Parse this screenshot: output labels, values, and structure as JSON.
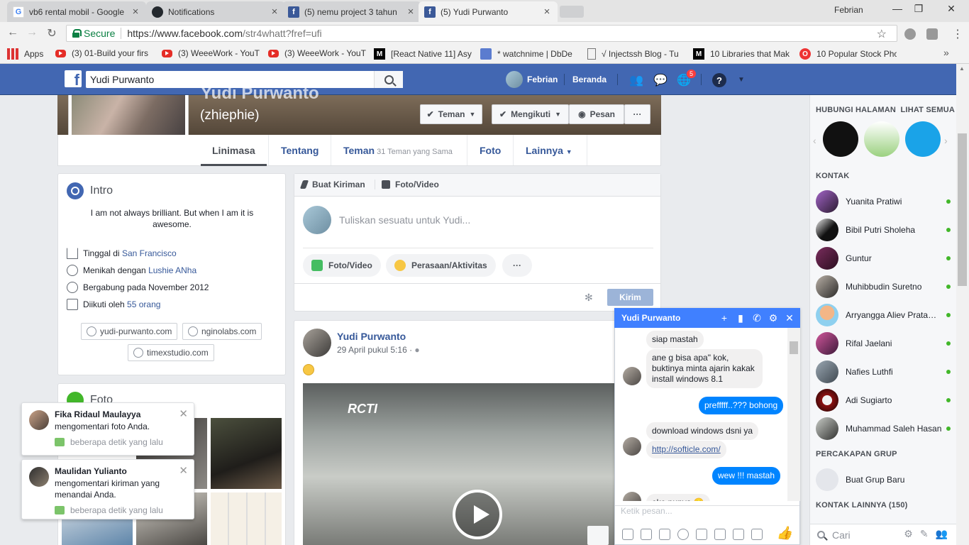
{
  "browser": {
    "tabs": [
      {
        "title": "vb6 rental mobil - Google",
        "favicon": "G",
        "color": "#4285f4"
      },
      {
        "title": "Notifications",
        "favicon": "github-icon",
        "color": "#24292e"
      },
      {
        "title": "(5) nemu project 3 tahun",
        "favicon": "f",
        "color": "#3b5998"
      },
      {
        "title": "(5) Yudi Purwanto",
        "favicon": "f",
        "color": "#3b5998"
      }
    ],
    "user": "Febrian",
    "secure_label": "Secure",
    "url_host": "https://www.facebook.com",
    "url_path": "/str4whatt?fref=ufi",
    "bookmarks": [
      {
        "label": "Apps",
        "icon": "apps-icon"
      },
      {
        "label": "(3) 01-Build your firs",
        "icon": "youtube-icon"
      },
      {
        "label": "(3) WeeeWork - YouT",
        "icon": "youtube-icon"
      },
      {
        "label": "(3) WeeeWork - YouT",
        "icon": "youtube-icon"
      },
      {
        "label": "[React Native 11] Asy",
        "icon": "medium-icon"
      },
      {
        "label": "* watchnime | DbDe",
        "icon": "page-icon"
      },
      {
        "label": "√ Injectssh Blog - Tu",
        "icon": "doc-icon"
      },
      {
        "label": "10 Libraries that Mak",
        "icon": "medium-icon"
      },
      {
        "label": "10 Popular Stock Pho",
        "icon": "opera-icon"
      }
    ]
  },
  "fb": {
    "search_value": "Yudi Purwanto",
    "user": "Febrian",
    "home": "Beranda",
    "notif_count": "5",
    "accent": "#4267b2"
  },
  "profile": {
    "name": "Yudi Purwanto",
    "alias": "(zhiephie)",
    "buttons": {
      "friends": "Teman",
      "following": "Mengikuti",
      "message": "Pesan",
      "more": "···"
    },
    "tabs": {
      "timeline": "Linimasa",
      "about": "Tentang",
      "friends": "Teman",
      "mutual": "31 Teman yang Sama",
      "photos": "Foto",
      "more": "Lainnya"
    }
  },
  "intro": {
    "title": "Intro",
    "bio": "I am not always brilliant. But when I am it is awesome.",
    "lives_prefix": "Tinggal di",
    "lives_city": "San Francisco",
    "married_prefix": "Menikah dengan",
    "married_name": "Lushie ANha",
    "joined": "Bergabung pada November 2012",
    "followed_prefix": "Diikuti oleh",
    "followed_count": "55 orang",
    "links": [
      "yudi-purwanto.com",
      "nginolabs.com",
      "timexstudio.com"
    ]
  },
  "photos": {
    "title": "Foto"
  },
  "composer": {
    "tab_post": "Buat Kiriman",
    "tab_photo": "Foto/Video",
    "placeholder": "Tuliskan sesuatu untuk Yudi...",
    "chip_photo": "Foto/Video",
    "chip_feeling": "Perasaan/Aktivitas",
    "chip_more": "···",
    "submit": "Kirim"
  },
  "post": {
    "author": "Yudi Purwanto",
    "date": "29 April pukul 5:16 · ",
    "video_text": "RCTI"
  },
  "notifications": [
    {
      "name": "Fika Ridaul Maulayya",
      "text": "mengomentari foto Anda.",
      "time": "beberapa detik yang lalu"
    },
    {
      "name": "Maulidan Yulianto",
      "text": "mengomentari kiriman yang menandai Anda.",
      "time": "beberapa detik yang lalu"
    }
  ],
  "chat": {
    "title": "Yudi Purwanto",
    "messages": [
      {
        "from": "them",
        "text": "siap mastah"
      },
      {
        "from": "them",
        "text": "ane g bisa apa\" kok, buktinya minta ajarin kakak install windows 8.1"
      },
      {
        "from": "me",
        "text": "prefffff..??? bohong"
      },
      {
        "from": "them",
        "text": "download windows dsni ya"
      },
      {
        "from": "them",
        "text": "http://softicle.com/"
      },
      {
        "from": "me",
        "text": "wew !!! mastah"
      },
      {
        "from": "them",
        "text": "oke  punya 😊"
      }
    ],
    "placeholder": "Ketik pesan..."
  },
  "sidebar": {
    "pages_header": "HUBUNGI HALAMAN",
    "see_all": "LIHAT SEMUA",
    "contacts_header": "KONTAK",
    "contacts": [
      "Yuanita Pratiwi",
      "Bibil Putri Sholeha",
      "Guntur",
      "Muhibbudin Suretno",
      "Arryangga Aliev Pratamaputra",
      "Rifal Jaelani",
      "Nafies Luthfi",
      "Adi Sugiarto",
      "Muhammad Saleh Hasan"
    ],
    "groups_header": "PERCAKAPAN GRUP",
    "new_group": "Buat Grup Baru",
    "more_header": "KONTAK LAINNYA (150)",
    "search_placeholder": "Cari"
  }
}
